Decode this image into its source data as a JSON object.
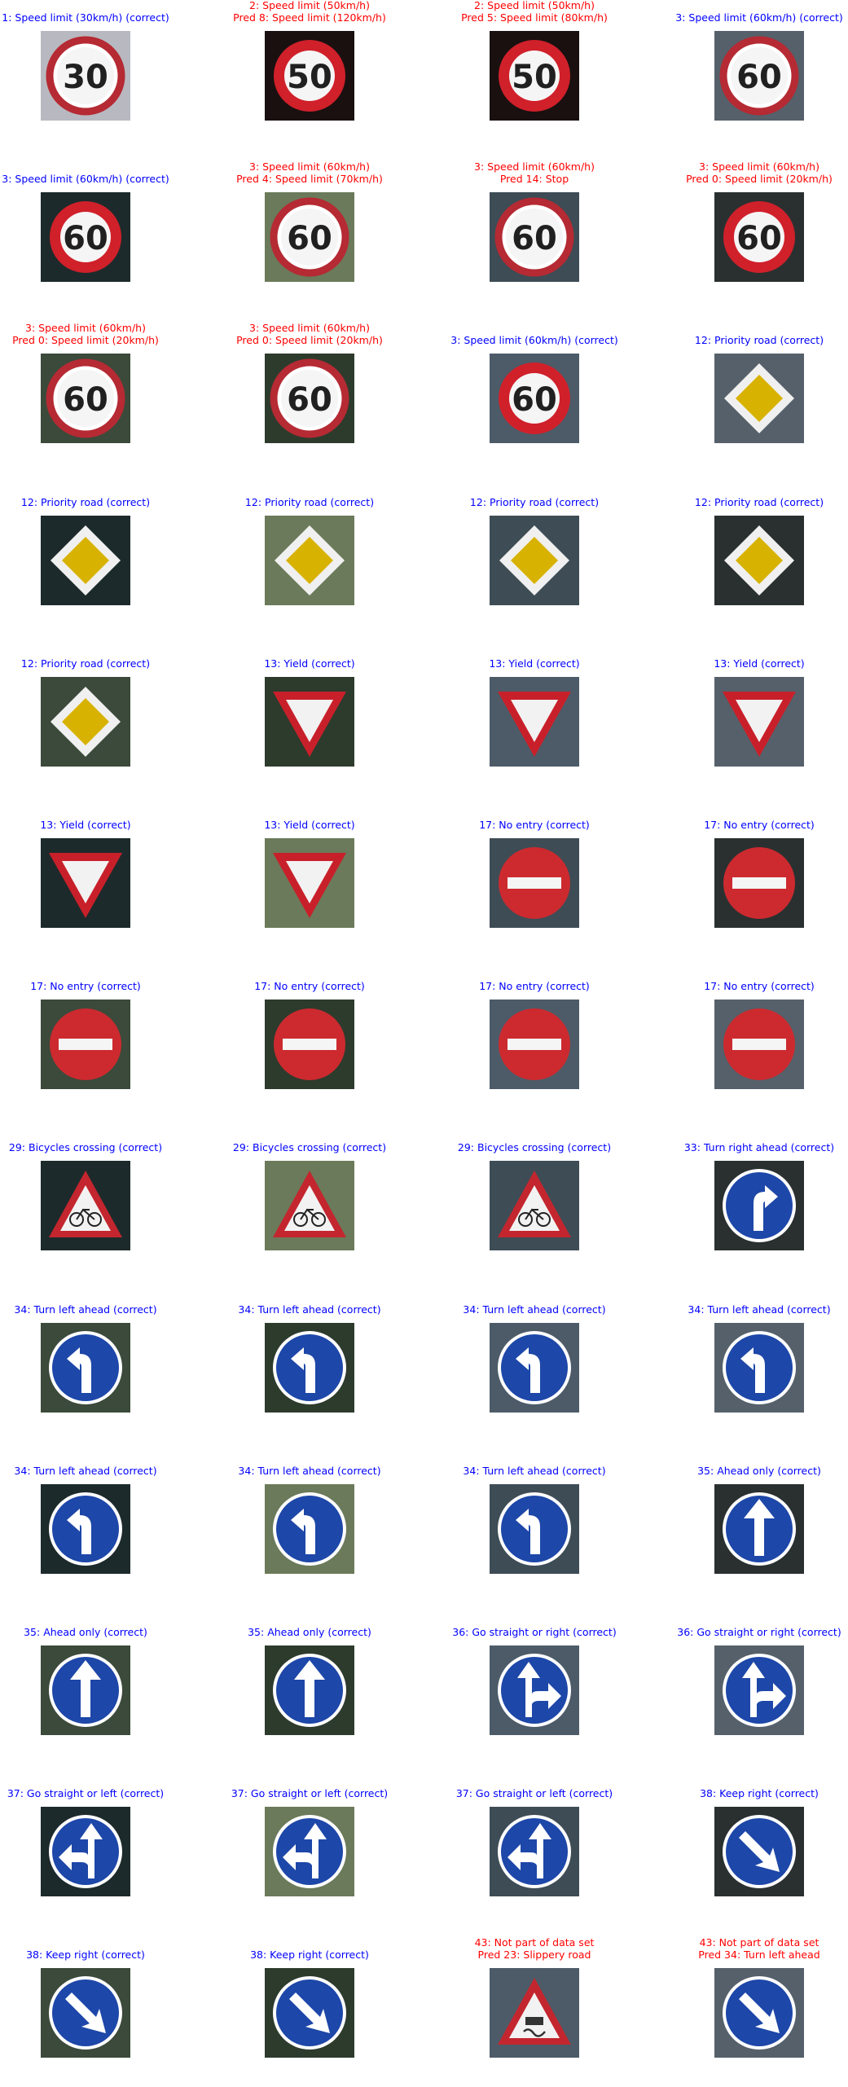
{
  "colors": {
    "correct": "#0000ff",
    "wrong": "#ff0000"
  },
  "tiles": [
    {
      "lines": [
        "1: Speed limit (30km/h) (correct)"
      ],
      "status": "correct",
      "icon": "speed-30-sign-icon"
    },
    {
      "lines": [
        "2: Speed limit (50km/h)",
        "Pred 8: Speed limit (120km/h)"
      ],
      "status": "wrong",
      "icon": "speed-50-sign-icon"
    },
    {
      "lines": [
        "2: Speed limit (50km/h)",
        "Pred 5: Speed limit (80km/h)"
      ],
      "status": "wrong",
      "icon": "speed-50-sign-icon"
    },
    {
      "lines": [
        "3: Speed limit (60km/h) (correct)"
      ],
      "status": "correct",
      "icon": "speed-60-sign-icon"
    },
    {
      "lines": [
        "3: Speed limit (60km/h) (correct)"
      ],
      "status": "correct",
      "icon": "speed-60-sign-icon"
    },
    {
      "lines": [
        "3: Speed limit (60km/h)",
        "Pred 4: Speed limit (70km/h)"
      ],
      "status": "wrong",
      "icon": "speed-60-sign-icon"
    },
    {
      "lines": [
        "3: Speed limit (60km/h)",
        "Pred 14: Stop"
      ],
      "status": "wrong",
      "icon": "speed-60-sign-icon"
    },
    {
      "lines": [
        "3: Speed limit (60km/h)",
        "Pred 0: Speed limit (20km/h)"
      ],
      "status": "wrong",
      "icon": "speed-60-sign-icon"
    },
    {
      "lines": [
        "3: Speed limit (60km/h)",
        "Pred 0: Speed limit (20km/h)"
      ],
      "status": "wrong",
      "icon": "speed-60-sign-icon"
    },
    {
      "lines": [
        "3: Speed limit (60km/h)",
        "Pred 0: Speed limit (20km/h)"
      ],
      "status": "wrong",
      "icon": "speed-60-sign-icon"
    },
    {
      "lines": [
        "3: Speed limit (60km/h) (correct)"
      ],
      "status": "correct",
      "icon": "speed-60-sign-icon"
    },
    {
      "lines": [
        "12: Priority road (correct)"
      ],
      "status": "correct",
      "icon": "priority-road-sign-icon"
    },
    {
      "lines": [
        "12: Priority road (correct)"
      ],
      "status": "correct",
      "icon": "priority-road-sign-icon"
    },
    {
      "lines": [
        "12: Priority road (correct)"
      ],
      "status": "correct",
      "icon": "priority-road-sign-icon"
    },
    {
      "lines": [
        "12: Priority road (correct)"
      ],
      "status": "correct",
      "icon": "priority-road-sign-icon"
    },
    {
      "lines": [
        "12: Priority road (correct)"
      ],
      "status": "correct",
      "icon": "priority-road-sign-icon"
    },
    {
      "lines": [
        "12: Priority road (correct)"
      ],
      "status": "correct",
      "icon": "priority-road-sign-icon"
    },
    {
      "lines": [
        "13: Yield (correct)"
      ],
      "status": "correct",
      "icon": "yield-sign-icon"
    },
    {
      "lines": [
        "13: Yield (correct)"
      ],
      "status": "correct",
      "icon": "yield-sign-icon"
    },
    {
      "lines": [
        "13: Yield (correct)"
      ],
      "status": "correct",
      "icon": "yield-sign-icon"
    },
    {
      "lines": [
        "13: Yield (correct)"
      ],
      "status": "correct",
      "icon": "yield-sign-icon"
    },
    {
      "lines": [
        "13: Yield (correct)"
      ],
      "status": "correct",
      "icon": "yield-sign-icon"
    },
    {
      "lines": [
        "17: No entry (correct)"
      ],
      "status": "correct",
      "icon": "no-entry-sign-icon"
    },
    {
      "lines": [
        "17: No entry (correct)"
      ],
      "status": "correct",
      "icon": "no-entry-sign-icon"
    },
    {
      "lines": [
        "17: No entry (correct)"
      ],
      "status": "correct",
      "icon": "no-entry-sign-icon"
    },
    {
      "lines": [
        "17: No entry (correct)"
      ],
      "status": "correct",
      "icon": "no-entry-sign-icon"
    },
    {
      "lines": [
        "17: No entry (correct)"
      ],
      "status": "correct",
      "icon": "no-entry-sign-icon"
    },
    {
      "lines": [
        "17: No entry (correct)"
      ],
      "status": "correct",
      "icon": "no-entry-sign-icon"
    },
    {
      "lines": [
        "29: Bicycles crossing (correct)"
      ],
      "status": "correct",
      "icon": "bicycles-crossing-sign-icon"
    },
    {
      "lines": [
        "29: Bicycles crossing (correct)"
      ],
      "status": "correct",
      "icon": "bicycles-crossing-sign-icon"
    },
    {
      "lines": [
        "29: Bicycles crossing (correct)"
      ],
      "status": "correct",
      "icon": "bicycles-crossing-sign-icon"
    },
    {
      "lines": [
        "33: Turn right ahead (correct)"
      ],
      "status": "correct",
      "icon": "turn-right-ahead-sign-icon"
    },
    {
      "lines": [
        "34: Turn left ahead (correct)"
      ],
      "status": "correct",
      "icon": "turn-left-ahead-sign-icon"
    },
    {
      "lines": [
        "34: Turn left ahead (correct)"
      ],
      "status": "correct",
      "icon": "turn-left-ahead-sign-icon"
    },
    {
      "lines": [
        "34: Turn left ahead (correct)"
      ],
      "status": "correct",
      "icon": "turn-left-ahead-sign-icon"
    },
    {
      "lines": [
        "34: Turn left ahead (correct)"
      ],
      "status": "correct",
      "icon": "turn-left-ahead-sign-icon"
    },
    {
      "lines": [
        "34: Turn left ahead (correct)"
      ],
      "status": "correct",
      "icon": "turn-left-ahead-sign-icon"
    },
    {
      "lines": [
        "34: Turn left ahead (correct)"
      ],
      "status": "correct",
      "icon": "turn-left-ahead-sign-icon"
    },
    {
      "lines": [
        "34: Turn left ahead (correct)"
      ],
      "status": "correct",
      "icon": "turn-left-ahead-sign-icon"
    },
    {
      "lines": [
        "35: Ahead only (correct)"
      ],
      "status": "correct",
      "icon": "ahead-only-sign-icon"
    },
    {
      "lines": [
        "35: Ahead only (correct)"
      ],
      "status": "correct",
      "icon": "ahead-only-sign-icon"
    },
    {
      "lines": [
        "35: Ahead only (correct)"
      ],
      "status": "correct",
      "icon": "ahead-only-sign-icon"
    },
    {
      "lines": [
        "36: Go straight or right (correct)"
      ],
      "status": "correct",
      "icon": "straight-or-right-sign-icon"
    },
    {
      "lines": [
        "36: Go straight or right (correct)"
      ],
      "status": "correct",
      "icon": "straight-or-right-sign-icon"
    },
    {
      "lines": [
        "37: Go straight or left (correct)"
      ],
      "status": "correct",
      "icon": "straight-or-left-sign-icon"
    },
    {
      "lines": [
        "37: Go straight or left (correct)"
      ],
      "status": "correct",
      "icon": "straight-or-left-sign-icon"
    },
    {
      "lines": [
        "37: Go straight or left (correct)"
      ],
      "status": "correct",
      "icon": "straight-or-left-sign-icon"
    },
    {
      "lines": [
        "38: Keep right (correct)"
      ],
      "status": "correct",
      "icon": "keep-right-sign-icon"
    },
    {
      "lines": [
        "38: Keep right (correct)"
      ],
      "status": "correct",
      "icon": "keep-right-sign-icon"
    },
    {
      "lines": [
        "38: Keep right (correct)"
      ],
      "status": "correct",
      "icon": "keep-right-sign-icon"
    },
    {
      "lines": [
        "43: Not part of data set",
        "Pred 23: Slippery road"
      ],
      "status": "wrong",
      "icon": "slippery-road-warning-sign-icon"
    },
    {
      "lines": [
        "43: Not part of data set",
        "Pred 34: Turn left ahead"
      ],
      "status": "wrong",
      "icon": "keep-right-sign-icon"
    }
  ]
}
